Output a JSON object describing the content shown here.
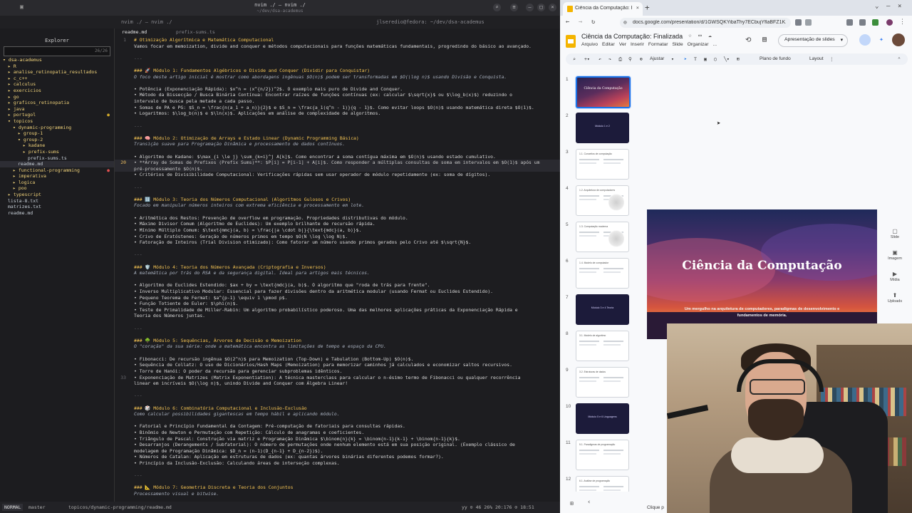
{
  "terminal": {
    "title": "nvim ./ — nvim ./",
    "subtitle": "~/dev/dsa-academus",
    "tab_left": "nvim ./ — nvim ./",
    "tab_right": "jlseredio@fedora: ~/dev/dsa-academus"
  },
  "explorer": {
    "title": "Explorer",
    "search_count": "26/26",
    "items": [
      {
        "label": "▾ dsa-academus",
        "indent": 0,
        "kind": "dir",
        "mark": ""
      },
      {
        "label": "▸ R",
        "indent": 1,
        "kind": "dir",
        "mark": ""
      },
      {
        "label": "▸ analise_retinopatia_resultados",
        "indent": 1,
        "kind": "dir",
        "mark": ""
      },
      {
        "label": "▸ c_c++",
        "indent": 1,
        "kind": "dir",
        "mark": ""
      },
      {
        "label": "▸ calculus",
        "indent": 1,
        "kind": "dir",
        "mark": ""
      },
      {
        "label": "▸ exercicios",
        "indent": 1,
        "kind": "dir",
        "mark": ""
      },
      {
        "label": "▸ go",
        "indent": 1,
        "kind": "dir",
        "mark": ""
      },
      {
        "label": "▸ graficos_retinopatia",
        "indent": 1,
        "kind": "dir",
        "mark": ""
      },
      {
        "label": "▸ java",
        "indent": 1,
        "kind": "dir",
        "mark": ""
      },
      {
        "label": "▸ portugol",
        "indent": 1,
        "kind": "dir",
        "mark": "●"
      },
      {
        "label": "▾ topicos",
        "indent": 1,
        "kind": "dir",
        "mark": ""
      },
      {
        "label": "▾ dynamic-programming",
        "indent": 2,
        "kind": "dir",
        "mark": ""
      },
      {
        "label": "▸ group-1",
        "indent": 3,
        "kind": "dir",
        "mark": ""
      },
      {
        "label": "▾ group-2",
        "indent": 3,
        "kind": "dir",
        "mark": ""
      },
      {
        "label": "▸ kadane",
        "indent": 4,
        "kind": "dir",
        "mark": ""
      },
      {
        "label": "▸ prefix-sums",
        "indent": 4,
        "kind": "dir",
        "mark": ""
      },
      {
        "label": "prefix-sums.ts",
        "indent": 5,
        "kind": "file",
        "mark": ""
      },
      {
        "label": "readme.md",
        "indent": 3,
        "kind": "file",
        "mark": "",
        "highlight": true
      },
      {
        "label": "▸ functional-programming",
        "indent": 2,
        "kind": "dir",
        "mark": "●",
        "mark_red": true
      },
      {
        "label": "▸ imperativa",
        "indent": 2,
        "kind": "dir",
        "mark": ""
      },
      {
        "label": "▸ logica",
        "indent": 2,
        "kind": "dir",
        "mark": ""
      },
      {
        "label": "▸ poo",
        "indent": 2,
        "kind": "dir",
        "mark": ""
      },
      {
        "label": "▸ typescript",
        "indent": 1,
        "kind": "dir",
        "mark": ""
      },
      {
        "label": "lista-8.txt",
        "indent": 1,
        "kind": "file",
        "mark": ""
      },
      {
        "label": "matrizes.txt",
        "indent": 1,
        "kind": "file",
        "mark": ""
      },
      {
        "label": "readme.md",
        "indent": 1,
        "kind": "file",
        "mark": ""
      }
    ]
  },
  "editor": {
    "active_tab": "readme.md",
    "other_tab": "prefix-sums.ts",
    "current_line": 20,
    "lines": [
      {
        "n": "1",
        "t": "# Otimização Algorítmica e Matemática Computacional",
        "k": "h1"
      },
      {
        "n": "",
        "t": "Vamos focar em memoization, divide and conquer e métodos computacionais para funções matemáticas fundamentais, progredindo do básico ao avançado.",
        "k": "bl"
      },
      {
        "n": "",
        "t": "",
        "k": ""
      },
      {
        "n": "",
        "t": "---",
        "k": "sep"
      },
      {
        "n": "",
        "t": "",
        "k": ""
      },
      {
        "n": "",
        "t": "### 🚀 Módulo 1: Fundamentos Algébricos e Divide and Conquer (Dividir para Conquistar)",
        "k": "h3"
      },
      {
        "n": "",
        "t": "O foco deste artigo inicial é mostrar como abordagens ingênuas $O(n)$ podem ser transformadas em $O(\\log n)$ usando Divisão e Conquista.",
        "k": "it"
      },
      {
        "n": "",
        "t": "",
        "k": ""
      },
      {
        "n": "",
        "t": "•   Potência (Exponenciação Rápida): $x^n = (x^{n/2})^2$. O exemplo mais puro de Divide and Conquer.",
        "k": "bl"
      },
      {
        "n": "",
        "t": "•   Método da Bissecção / Busca Binária Contínua: Encontrar raízes de funções contínuas (ex: calcular $\\sqrt{x}$ ou $\\log_b(x)$) reduzindo o",
        "k": "bl"
      },
      {
        "n": "",
        "t": "intervalo de busca pela metade a cada passo.",
        "k": "bl"
      },
      {
        "n": "",
        "t": "•   Somas de PA e PG: $S_n = \\frac{n(a_1 + a_n)}{2}$ e $S_n = \\frac{a_1(q^n - 1)}{q - 1}$. Como evitar loops $O(n)$ usando matemática direta $O(1)$.",
        "k": "bl"
      },
      {
        "n": "",
        "t": "•   Logaritmos: $\\log_b(n)$ e $\\ln(x)$. Aplicações em análise de complexidade de algoritmos.",
        "k": "bl"
      },
      {
        "n": "",
        "t": "",
        "k": ""
      },
      {
        "n": "",
        "t": "---",
        "k": "sep"
      },
      {
        "n": "",
        "t": "",
        "k": ""
      },
      {
        "n": "",
        "t": "### 🧠 Módulo 2: Otimização de Arrays e Estado Linear (Dynamic Programming Básica)",
        "k": "h3"
      },
      {
        "n": "",
        "t": "Transição suave para Programação Dinâmica e processamento de dados contínuos.",
        "k": "it"
      },
      {
        "n": "",
        "t": "",
        "k": ""
      },
      {
        "n": "",
        "t": "•   Algoritmo de Kadane: $\\max_{i \\le j} \\sum_{k=i}^j A[k]$. Como encontrar a soma contígua máxima em $O(n)$ usando estado cumulativo.",
        "k": "bl"
      },
      {
        "n": "20",
        "t": "•   **Array de Somas de Prefixos (Prefix Sums)**: $P[i] = P[i-1] + A[i]$. Como responder a múltiplas consultas de soma em intervalos em $O(1)$ após um",
        "k": "cur"
      },
      {
        "n": "",
        "t": "pré-processamento $O(n)$.",
        "k": "cur"
      },
      {
        "n": "",
        "t": "•   Critérios de Divisibilidade Computacional: Verificações rápidas sem usar operador de módulo repetidamente (ex: soma de dígitos).",
        "k": "bl"
      },
      {
        "n": "",
        "t": "",
        "k": ""
      },
      {
        "n": "",
        "t": "---",
        "k": "sep"
      },
      {
        "n": "",
        "t": "",
        "k": ""
      },
      {
        "n": "",
        "t": "### 🔢 Módulo 3: Teoria dos Números Computacional (Algoritmos Gulosos e Crivos)",
        "k": "h3"
      },
      {
        "n": "",
        "t": "Focado em manipular números inteiros com extrema eficiência e processamento em lote.",
        "k": "it"
      },
      {
        "n": "",
        "t": "",
        "k": ""
      },
      {
        "n": "",
        "t": "•   Aritmética dos Restos: Prevenção de overflow em programação. Propriedades distributivas do módulo.",
        "k": "bl"
      },
      {
        "n": "",
        "t": "•   Máximo Divisor Comum (Algoritmo de Euclides): Um exemplo brilhante de recursão rápida.",
        "k": "bl"
      },
      {
        "n": "",
        "t": "•   Mínimo Múltiplo Comum: $\\text{mmc}(a, b) = \\frac{|a \\cdot b|}{\\text{mdc}(a, b)}$.",
        "k": "bl"
      },
      {
        "n": "",
        "t": "•   Crivo de Eratóstenes: Geração de números primos em tempo $O(N \\log \\log N)$.",
        "k": "bl"
      },
      {
        "n": "",
        "t": "•   Fatoração de Inteiros (Trial Division otimizado): Como fatorar um número usando primos gerados pelo Crivo até $\\sqrt{N}$.",
        "k": "bl"
      },
      {
        "n": "",
        "t": "",
        "k": ""
      },
      {
        "n": "",
        "t": "---",
        "k": "sep"
      },
      {
        "n": "",
        "t": "",
        "k": ""
      },
      {
        "n": "",
        "t": "### 🛡️ Módulo 4: Teoria dos Números Avançada (Criptografia e Inversos)",
        "k": "h3"
      },
      {
        "n": "",
        "t": "A matemática por trás do RSA e da segurança digital. Ideal para artigos mais técnicos.",
        "k": "it"
      },
      {
        "n": "",
        "t": "",
        "k": ""
      },
      {
        "n": "",
        "t": "•   Algoritmo de Euclides Estendido: $ax + by = \\text{mdc}(a, b)$. O algoritmo que \"roda de trás para frente\".",
        "k": "bl"
      },
      {
        "n": "",
        "t": "•   Inverso Multiplicativo Modular: Essencial para fazer divisões dentro da aritmética modular (usando Fermat ou Euclides Estendido).",
        "k": "bl"
      },
      {
        "n": "",
        "t": "•   Pequeno Teorema de Fermat: $a^{p-1} \\equiv 1 \\pmod p$.",
        "k": "bl"
      },
      {
        "n": "",
        "t": "•   Função Totiente de Euler: $\\phi(n)$.",
        "k": "bl"
      },
      {
        "n": "",
        "t": "•   Teste de Primalidade de Miller-Rabin: Um algoritmo probabilístico poderoso. Uma das melhores aplicações práticas da Exponenciação Rápida e",
        "k": "bl"
      },
      {
        "n": "",
        "t": "Teoria dos Números juntas.",
        "k": "bl"
      },
      {
        "n": "",
        "t": "",
        "k": ""
      },
      {
        "n": "",
        "t": "---",
        "k": "sep"
      },
      {
        "n": "",
        "t": "",
        "k": ""
      },
      {
        "n": "",
        "t": "### 🌳 Módulo 5: Sequências, Árvores de Decisão e Memoization",
        "k": "h3"
      },
      {
        "n": "",
        "t": "O \"coração\" da sua série: onde a matemática encontra as limitações de tempo e espaço da CPU.",
        "k": "it"
      },
      {
        "n": "",
        "t": "",
        "k": ""
      },
      {
        "n": "",
        "t": "•   Fibonacci: De recursão ingênua $O(2^n)$ para Memoization (Top-Down) e Tabulation (Bottom-Up) $O(n)$.",
        "k": "bl"
      },
      {
        "n": "",
        "t": "•   Sequência de Collatz: O uso de Dicionários/Hash Maps (Memoization) para memorizar caminhos já calculados e economizar saltos recursivos.",
        "k": "bl"
      },
      {
        "n": "",
        "t": "•   Torre de Hanói: O poder da recursão para gerenciar subproblemas idênticos.",
        "k": "bl"
      },
      {
        "n": "33",
        "t": "•   Exponenciação de Matrizes (Matrix Exponentiation): A técnica masterclass para calcular o n-ésimo termo de Fibonacci ou qualquer recorrência",
        "k": "bl"
      },
      {
        "n": "",
        "t": "linear em incríveis $O(\\log n)$, unindo Divide and Conquer com Álgebra Linear!",
        "k": "bl"
      },
      {
        "n": "",
        "t": "",
        "k": ""
      },
      {
        "n": "",
        "t": "---",
        "k": "sep"
      },
      {
        "n": "",
        "t": "",
        "k": ""
      },
      {
        "n": "",
        "t": "### 🎲 Módulo 6: Combinatória Computacional e Inclusão-Exclusão",
        "k": "h3"
      },
      {
        "n": "",
        "t": "Como calcular possibilidades gigantescas em tempo hábil e aplicando módulo.",
        "k": "it"
      },
      {
        "n": "",
        "t": "",
        "k": ""
      },
      {
        "n": "",
        "t": "•   Fatorial e Princípio Fundamental da Contagem: Pré-computação de fatoriais para consultas rápidas.",
        "k": "bl"
      },
      {
        "n": "",
        "t": "•   Binômio de Newton e Permutação com Repetição: Cálculo de anagramas e coeficientes.",
        "k": "bl"
      },
      {
        "n": "",
        "t": "•   Triângulo de Pascal: Construção via matriz e Programação Dinâmica $\\binom{n}{k} = \\binom{n-1}{k-1} + \\binom{n-1}{k}$.",
        "k": "bl"
      },
      {
        "n": "",
        "t": "•   Desarranjos (Derangements / Subfatorial): O número de permutações onde nenhum elemento está em sua posição original. (Exemplo clássico de",
        "k": "bl"
      },
      {
        "n": "",
        "t": "modelagem de Programação Dinâmica: $D_n = (n-1)(D_{n-1} + D_{n-2})$).",
        "k": "bl"
      },
      {
        "n": "",
        "t": "•   Números de Catalan: Aplicação em estruturas de dados (ex: quantas árvores binárias diferentes podemos formar?).",
        "k": "bl"
      },
      {
        "n": "",
        "t": "•   Princípio da Inclusão-Exclusão: Calculando áreas de interseção complexas.",
        "k": "bl"
      },
      {
        "n": "",
        "t": "",
        "k": ""
      },
      {
        "n": "",
        "t": "---",
        "k": "sep"
      },
      {
        "n": "",
        "t": "",
        "k": ""
      },
      {
        "n": "",
        "t": "### 📐 Módulo 7: Geometria Discreta e Teoria dos Conjuntos",
        "k": "h3"
      },
      {
        "n": "",
        "t": "Processamento visual e bitwise.",
        "k": "it"
      }
    ]
  },
  "statusline": {
    "mode": "NORMAL",
    "branch": " master",
    "path": "topicos/dynamic-programming/readme.md",
    "right": "yy  ⊙ 46    26%  20:176  ⊙  18:51"
  },
  "browser": {
    "tab_label": "Ciência da Computação: Fi",
    "url": "docs.google.com/presentation/d/1GWSQKYibaThy7ECbujYflaBFZ1K...",
    "doc_title": "Ciência da Computação: Finalizada",
    "menus": [
      "Arquivo",
      "Editar",
      "Ver",
      "Inserir",
      "Formatar",
      "Slide",
      "Organizar",
      "..."
    ],
    "present_label": "Apresentação de slides",
    "toolbar": {
      "adjust": "Ajustar",
      "background": "Plano de fundo",
      "layout": "Layout"
    },
    "slide_numbers": [
      "1",
      "2",
      "3",
      "4",
      "5",
      "6",
      "7",
      "8",
      "9",
      "10",
      "11",
      "12"
    ],
    "thumb_titles": [
      "Ciência da Computação",
      "Módulo 1 e 2",
      "1.1. Conceitos de computação",
      "1.2. Arquitetura de computadores",
      "1.3. Computação moderna",
      "1.4. Modelo de computador",
      "Módulo 3 e 4 Teoria",
      "3.1. Modelo de algoritmo",
      "3.2. Estruturas de dados",
      "Módulo 5 e 6 Linguagens",
      "5.1. Paradigmas de programação",
      "6.1. Análise de programação"
    ],
    "slide": {
      "title": "Ciência da Computação",
      "subtitle": "Um mergulho na arquitetura de computadores, paradigmas de desenvolvimento e fundamentos de memória."
    },
    "side_panel": [
      "Slide",
      "Imagem",
      "Mídia",
      "Uploads"
    ],
    "bottom_hint": "Clique p"
  }
}
